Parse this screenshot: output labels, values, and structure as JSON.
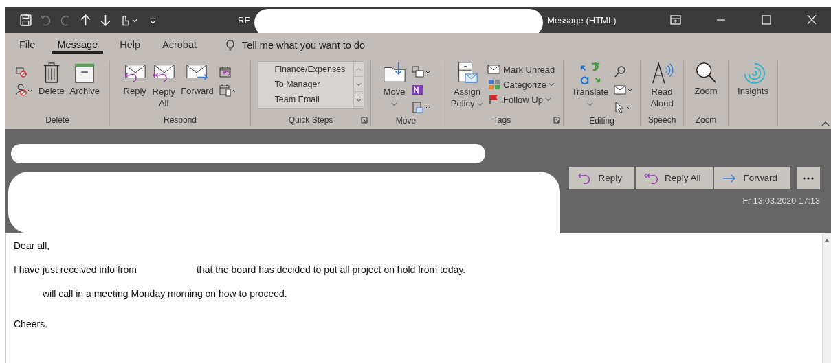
{
  "window": {
    "title_prefix": "RE",
    "title_suffix": "Message (HTML)"
  },
  "ribbon_tabs": [
    {
      "label": "File",
      "selected": false
    },
    {
      "label": "Message",
      "selected": true
    },
    {
      "label": "Help",
      "selected": false
    },
    {
      "label": "Acrobat",
      "selected": false
    }
  ],
  "tell_me": {
    "placeholder": "Tell me what you want to do"
  },
  "ribbon": {
    "delete": {
      "label": "Delete",
      "delete": "Delete",
      "archive": "Archive"
    },
    "respond": {
      "label": "Respond",
      "reply": "Reply",
      "reply_all_1": "Reply",
      "reply_all_2": "All",
      "forward": "Forward"
    },
    "quick_steps": {
      "label": "Quick Steps",
      "items": [
        "Finance/Expenses",
        "To Manager",
        "Team Email"
      ]
    },
    "move": {
      "label": "Move",
      "move": "Move"
    },
    "tags": {
      "label": "Tags",
      "assign_1": "Assign",
      "assign_2": "Policy",
      "mark_unread": "Mark Unread",
      "categorize": "Categorize",
      "follow_up": "Follow Up"
    },
    "editing": {
      "label": "Editing",
      "translate": "Translate"
    },
    "speech": {
      "label": "Speech",
      "read_1": "Read",
      "read_2": "Aloud"
    },
    "zoom": {
      "label": "Zoom",
      "zoom": "Zoom"
    },
    "insights": {
      "insights": "Insights"
    }
  },
  "reading_header": {
    "buttons": [
      "Reply",
      "Reply All",
      "Forward"
    ],
    "date": "Fr 13.03.2020 17:13"
  },
  "body": {
    "greeting": "Dear all,",
    "line_1a": "I have just received info from",
    "line_1b": "that the board has decided to put all project on hold from today.",
    "line_2": "will call in a meeting Monday morning on how to proceed.",
    "closing": "Cheers."
  }
}
